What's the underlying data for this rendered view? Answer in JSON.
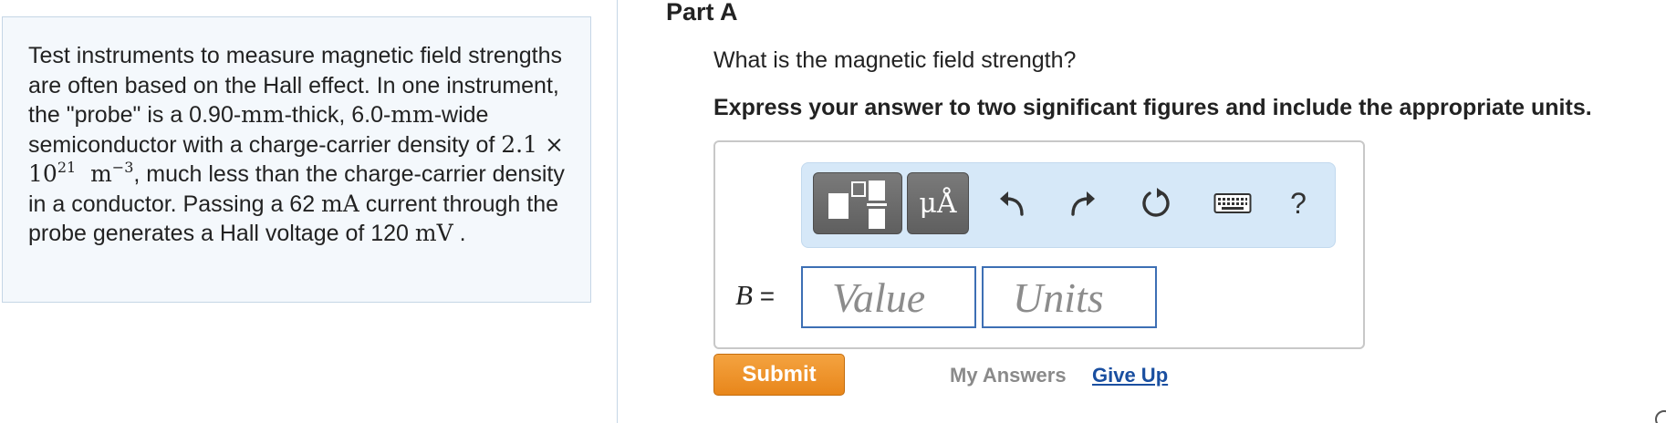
{
  "problem": {
    "text_1": "Test instruments to measure magnetic field strengths are often based on the Hall effect. In one instrument, the \"probe\" is a 0.90-",
    "unit_mm_1": "mm",
    "text_2": "-thick, 6.0-",
    "unit_mm_2": "mm",
    "text_3": "-wide semiconductor with a charge-carrier density of ",
    "density_coef": "2.1 × 10",
    "density_exp": "21",
    "density_unit": "m",
    "density_unit_exp": "−3",
    "text_4": ", much less than the charge-carrier density in a conductor. Passing a 62 ",
    "unit_mA": "mA",
    "text_5": " current through the probe generates a Hall voltage of 120 ",
    "unit_mV": "mV",
    "text_6": " ."
  },
  "part": {
    "title": "Part A",
    "question": "What is the magnetic field strength?",
    "instruction": "Express your answer to two significant figures and include the appropriate units."
  },
  "toolbar": {
    "units_label": "μÅ",
    "help_label": "?"
  },
  "answer": {
    "variable": "B",
    "equals": " =",
    "value_placeholder": "Value",
    "units_placeholder": "Units"
  },
  "actions": {
    "submit_label": "Submit",
    "my_answers_label": "My Answers",
    "give_up_label": "Give Up"
  },
  "colors": {
    "submit": "#e8861b",
    "link": "#1a4fa0",
    "toolbar_bg": "#d6e8f8",
    "input_border": "#3d6fb4"
  },
  "icons": [
    "template-icon",
    "undo-icon",
    "redo-icon",
    "reset-icon",
    "keyboard-icon"
  ]
}
